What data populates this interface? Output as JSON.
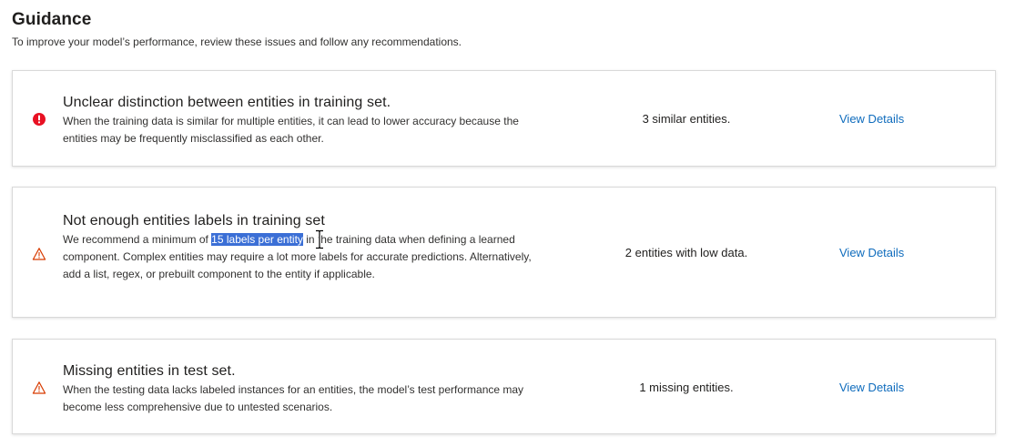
{
  "page": {
    "title": "Guidance",
    "subtitle": "To improve your model’s performance, review these issues and follow any recommendations."
  },
  "cards": [
    {
      "icon": "error-icon",
      "icon_color": "#e81123",
      "title": "Unclear distinction between entities in training set.",
      "description": "When the training data is similar for multiple entities, it can lead to lower accuracy because the entities may be frequently misclassified as each other.",
      "metric": "3 similar entities.",
      "link": "View Details"
    },
    {
      "icon": "warning-icon",
      "icon_color": "#d83b01",
      "title": "Not enough entities labels in training set",
      "description_pre": "We recommend a minimum of ",
      "description_selected": "15 labels per entity",
      "description_post": " in the training data when defining a learned component. Complex entities may require a lot more labels for accurate predictions. Alternatively, add a list, regex, or prebuilt component to the entity if applicable.",
      "metric": "2 entities with low data.",
      "link": "View Details"
    },
    {
      "icon": "warning-icon",
      "icon_color": "#d83b01",
      "title": "Missing entities in test set.",
      "description": "When the testing data lacks labeled instances for an entities, the model’s test performance may become less comprehensive due to untested scenarios.",
      "metric": "1 missing entities.",
      "link": "View Details"
    }
  ],
  "colors": {
    "link": "#0f6cbd",
    "selection": "#3b6fd6",
    "card_border": "#d9d9d9"
  }
}
